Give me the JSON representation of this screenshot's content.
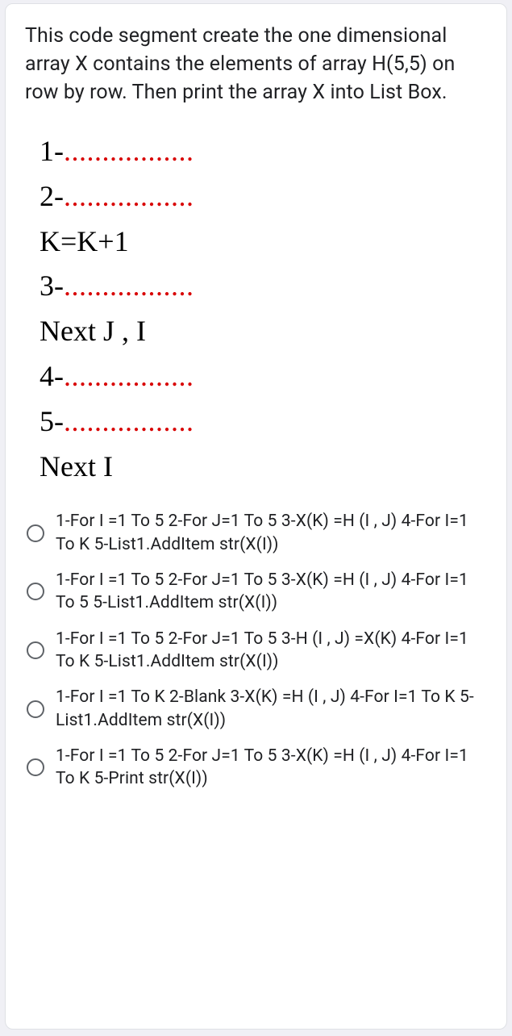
{
  "question": "This code segment create the one dimensional array X contains the elements of array H(5,5) on row by row. Then print the array X into List Box.",
  "code_lines": [
    {
      "prefix": "1-",
      "dots": true,
      "rest": ""
    },
    {
      "prefix": "2-",
      "dots": true,
      "rest": ""
    },
    {
      "prefix": "K=K+1",
      "dots": false,
      "rest": ""
    },
    {
      "prefix": "3-",
      "dots": true,
      "rest": ""
    },
    {
      "prefix": "Next J , I",
      "dots": false,
      "rest": ""
    },
    {
      "prefix": "4-",
      "dots": true,
      "rest": ""
    },
    {
      "prefix": "5-",
      "dots": true,
      "rest": ""
    },
    {
      "prefix": "Next I",
      "dots": false,
      "rest": ""
    }
  ],
  "dot_string": ".................",
  "options": [
    "1-For I =1 To 5 2-For J=1 To 5 3-X(K) =H (I , J) 4-For I=1 To K 5-List1.AddItem str(X(I))",
    "1-For I =1 To 5 2-For J=1 To 5 3-X(K) =H (I , J) 4-For I=1 To 5 5-List1.AddItem str(X(I))",
    "1-For I =1 To 5 2-For J=1 To 5 3-H (I , J) =X(K) 4-For I=1 To K 5-List1.AddItem str(X(I))",
    "1-For I =1 To K 2-Blank 3-X(K) =H (I , J) 4-For I=1 To K 5-List1.AddItem str(X(I))",
    "1-For I =1 To 5 2-For J=1 To 5 3-X(K) =H (I , J) 4-For I=1 To K 5-Print str(X(I))"
  ]
}
